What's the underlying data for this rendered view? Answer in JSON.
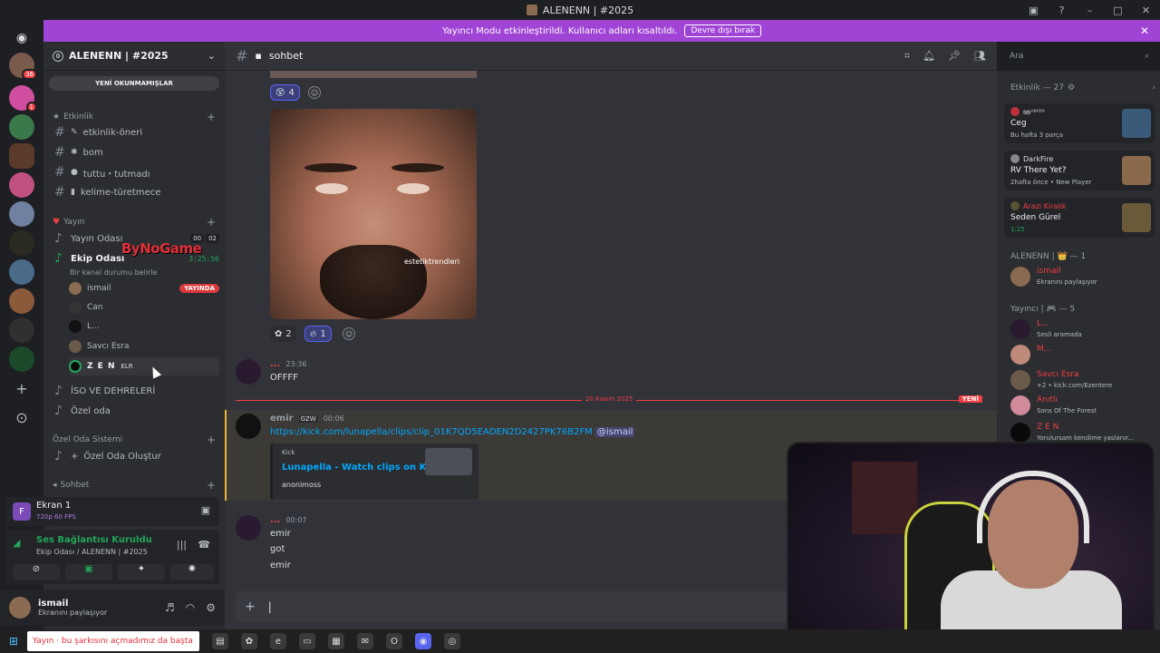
{
  "window": {
    "title": "ALENENN | #2025",
    "controls": [
      "▣",
      "?",
      "–",
      "□",
      "✕"
    ]
  },
  "banner": {
    "text": "Yayıncı Modu etkinleştirildi. Kullanıcı adları kısaltıldı.",
    "button": "Devre dışı bırak",
    "close": "✕"
  },
  "guilds": {
    "badge_main": "36",
    "badge_second": "1",
    "add": "+",
    "explore": "⊙"
  },
  "server": {
    "zero": "0",
    "name": "ALENENN | #2025",
    "unread_pill": "YENİ OKUNMAMIŞLAR",
    "categories": {
      "etkinlik": "Etkinlik",
      "yayin": "Yayın",
      "ozel_oda": "Özel Oda Sistemi",
      "sohbet": "Sohbet"
    },
    "channels": {
      "etkinlik_oneri": "etkinlik-öneri",
      "bom": "bom",
      "tuttu": "tuttu・tutmadı",
      "kelime": "kelime-türetmece",
      "yayin_odasi": "Yayın Odası",
      "ekip_odasi": "Ekip Odası",
      "ekip_status": "Bir kanal durumu belirle",
      "iso": "İSO VE DEHRELERİ",
      "ozel_oda": "Özel oda",
      "ozel_oda_olustur": "Özel Oda Oluştur"
    },
    "yayin_counts": [
      "00",
      "02"
    ],
    "ekip_timer": "3:25:56",
    "voice_users": [
      {
        "name": "ismail",
        "badge": "YAYINDA"
      },
      {
        "name": "Can"
      },
      {
        "name": "L..."
      },
      {
        "name": "Savcı Esra"
      },
      {
        "name": "Z E N",
        "tag": "ELR"
      }
    ]
  },
  "screen_panel": {
    "title": "Ekran 1",
    "quality": "720p 60 FPS"
  },
  "voice_panel": {
    "status": "Ses Bağlantısı Kuruldu",
    "location": "Ekip Odası / ALENENN | #2025"
  },
  "user": {
    "name": "ismail",
    "status": "Ekranını paylaşıyor"
  },
  "channel": {
    "name": "sohbet",
    "search_placeholder": "Ara"
  },
  "messages": {
    "top_reactions": {
      "count1": "4"
    },
    "image_watermark": "estetiktrendleri",
    "image_reactions": {
      "count1": "2",
      "count2": "1"
    },
    "msg1": {
      "author": "...",
      "time": "23:36",
      "text": "OFFFF"
    },
    "divider": {
      "date": "20 Kasım 2025",
      "new_label": "YENİ"
    },
    "msg2": {
      "author": "emir",
      "tag": "GZW",
      "time": "00:06",
      "link": "https://kick.com/lunapella/clips/clip_01K7QD5EADEN2D2427PK76B2FM",
      "mention": "@ismail"
    },
    "embed": {
      "provider": "Kick",
      "title": "Lunapella - Watch clips on Kick",
      "desc": "anonimoss"
    },
    "msg3": {
      "author": "...",
      "time": "00:07",
      "lines": [
        "emir",
        "got",
        "emir"
      ]
    }
  },
  "members": {
    "activity_header": "Etkinlik — 27",
    "activities": [
      {
        "user": "ᵴᵴᴬᵇᴵᴳᴵᵗ",
        "game": "Ceg",
        "sub": "Bu hafta 3 parça"
      },
      {
        "user": "DarkFire",
        "game": "RV There Yet?",
        "sub": "2hafta önce  •  New Player"
      },
      {
        "user": "Arazi Kiralık",
        "game": "Seden Gürel",
        "sub": "1:25"
      }
    ],
    "section1": "ALENENN | 👑 — 1",
    "sec1_members": [
      {
        "name": "ismail",
        "status": "Ekranını paylaşıyor"
      }
    ],
    "section2": "Yayıncı | 🎮 — 5",
    "sec2_members": [
      {
        "name": "L...",
        "status": "Sesli aramada"
      },
      {
        "name": "M...",
        "status": ""
      },
      {
        "name": "Savcı Esra",
        "status": "+2 • kick.com/Ezentere"
      },
      {
        "name": "Anıtlı",
        "status": "Sons Of The Forest"
      },
      {
        "name": "Z E N",
        "status": "Yorulursam kendime yaslanır..."
      }
    ]
  },
  "overlay": {
    "logo": "ByNoGame"
  },
  "taskbar": {
    "search_text": "Yayın · bu şarkısını açmadımız da başta"
  }
}
